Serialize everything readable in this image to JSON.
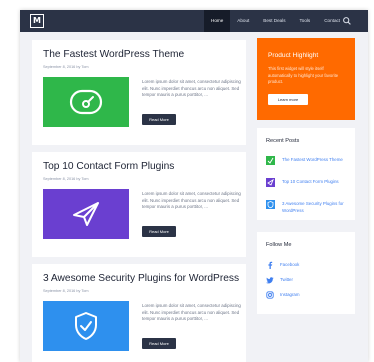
{
  "header": {
    "logo_text": "M",
    "nav": [
      {
        "label": "Home"
      },
      {
        "label": "About"
      },
      {
        "label": "Best Deals"
      },
      {
        "label": "Tools"
      },
      {
        "label": "Contact"
      }
    ]
  },
  "posts": [
    {
      "title": "The Fastest WordPress Theme",
      "meta": "September 8, 2016 by Tom",
      "excerpt": "Lorem ipsum dolor sit amet, consectetur adipiscing elit. Nunc imperdiet rhoncus arcu non aliquet. Sed tempor mauris a purus porttitor, ...",
      "read_more": "Read More",
      "thumb_color": "#2fb74a",
      "thumb_icon": "speedometer-icon"
    },
    {
      "title": "Top 10 Contact Form Plugins",
      "meta": "September 8, 2016 by Tom",
      "excerpt": "Lorem ipsum dolor sit amet, consectetur adipiscing elit. Nunc imperdiet rhoncus arcu non aliquet. Sed tempor mauris a purus porttitor, ...",
      "read_more": "Read More",
      "thumb_color": "#6a3fd0",
      "thumb_icon": "paper-plane-icon"
    },
    {
      "title": "3 Awesome Security Plugins for WordPress",
      "meta": "September 8, 2016 by Tom",
      "excerpt": "Lorem ipsum dolor sit amet, consectetur adipiscing elit. Nunc imperdiet rhoncus arcu non aliquet. Sed tempor mauris a purus porttitor, ...",
      "read_more": "Read More",
      "thumb_color": "#2e90ee",
      "thumb_icon": "shield-check-icon"
    }
  ],
  "sidebar": {
    "highlight": {
      "title": "Product Highlight",
      "text": "This first widget will style itself automatically to highlight your favorite product.",
      "button": "Learn more",
      "color": "#ff6a00"
    },
    "recent": {
      "title": "Recent Posts",
      "items": [
        {
          "label": "The Fastest WordPress Theme",
          "color": "#2fb74a"
        },
        {
          "label": "Top 10 Contact Form Plugins",
          "color": "#6a3fd0"
        },
        {
          "label": "3 Awesome Security Plugins for WordPress",
          "color": "#2e90ee"
        }
      ]
    },
    "follow": {
      "title": "Follow Me",
      "items": [
        {
          "label": "Facebook",
          "icon": "facebook-icon"
        },
        {
          "label": "Twitter",
          "icon": "twitter-icon"
        },
        {
          "label": "Instagram",
          "icon": "instagram-icon"
        }
      ]
    }
  },
  "colors": {
    "header_bg": "#2b3346",
    "page_bg": "#f1f2f6",
    "link": "#3f7ff0"
  }
}
